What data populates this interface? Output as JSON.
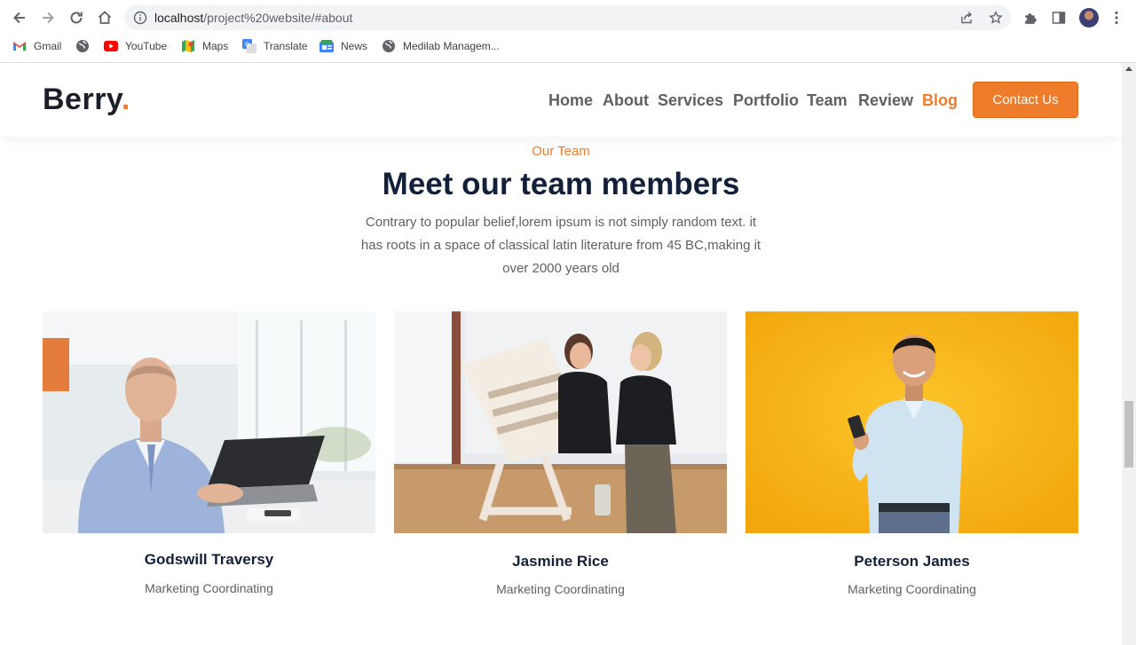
{
  "browser": {
    "url_host": "localhost",
    "url_path": "/project%20website/#about",
    "bookmarks": [
      {
        "label": "Gmail",
        "icon": "gmail-icon"
      },
      {
        "label": "",
        "icon": "globe-icon"
      },
      {
        "label": "YouTube",
        "icon": "youtube-icon"
      },
      {
        "label": "Maps",
        "icon": "maps-icon"
      },
      {
        "label": "Translate",
        "icon": "translate-icon"
      },
      {
        "label": "News",
        "icon": "news-icon"
      },
      {
        "label": "Medilab Managem...",
        "icon": "globe-icon"
      }
    ]
  },
  "site": {
    "logo_text": "Berry",
    "logo_dot": ".",
    "nav": [
      {
        "label": "Home"
      },
      {
        "label": "About"
      },
      {
        "label": "Services"
      },
      {
        "label": "Portfolio"
      },
      {
        "label": "Team"
      },
      {
        "label": "Review"
      },
      {
        "label": "Blog",
        "active": true
      }
    ],
    "cta_label": "Contact Us"
  },
  "team": {
    "eyebrow": "Our Team",
    "title": "Meet our team members",
    "lead": "Contrary to popular belief,lorem ipsum is not simply random text. it has roots in a space of classical latin literature from 45 BC,making it over 2000 years old",
    "members": [
      {
        "name": "Godswill Traversy",
        "role": "Marketing Coordinating"
      },
      {
        "name": "Jasmine Rice",
        "role": "Marketing Coordinating"
      },
      {
        "name": "Peterson James",
        "role": "Marketing Coordinating"
      }
    ]
  },
  "colors": {
    "accent": "#ef7c2b",
    "heading": "#13203a",
    "body_text": "#5e6164"
  }
}
